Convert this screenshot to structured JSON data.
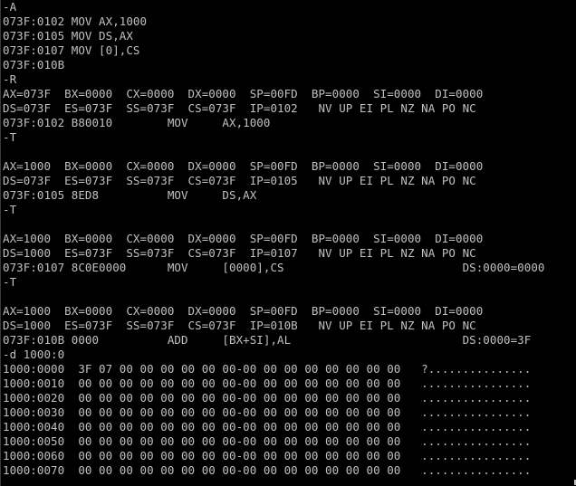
{
  "console": {
    "lines": [
      "-A",
      "073F:0102 MOV AX,1000",
      "073F:0105 MOV DS,AX",
      "073F:0107 MOV [0],CS",
      "073F:010B",
      "-R",
      "AX=073F  BX=0000  CX=0000  DX=0000  SP=00FD  BP=0000  SI=0000  DI=0000",
      "DS=073F  ES=073F  SS=073F  CS=073F  IP=0102   NV UP EI PL NZ NA PO NC",
      "073F:0102 B80010        MOV     AX,1000",
      "-T",
      "",
      "AX=1000  BX=0000  CX=0000  DX=0000  SP=00FD  BP=0000  SI=0000  DI=0000",
      "DS=073F  ES=073F  SS=073F  CS=073F  IP=0105   NV UP EI PL NZ NA PO NC",
      "073F:0105 8ED8          MOV     DS,AX",
      "-T",
      "",
      "AX=1000  BX=0000  CX=0000  DX=0000  SP=00FD  BP=0000  SI=0000  DI=0000",
      "DS=1000  ES=073F  SS=073F  CS=073F  IP=0107   NV UP EI PL NZ NA PO NC",
      "073F:0107 8C0E0000      MOV     [0000],CS                          DS:0000=0000",
      "-T",
      "",
      "AX=1000  BX=0000  CX=0000  DX=0000  SP=00FD  BP=0000  SI=0000  DI=0000",
      "DS=1000  ES=073F  SS=073F  CS=073F  IP=010B   NV UP EI PL NZ NA PO NC",
      "073F:010B 0000          ADD     [BX+SI],AL                         DS:0000=3F",
      "-d 1000:0",
      "1000:0000  3F 07 00 00 00 00 00 00-00 00 00 00 00 00 00 00   ?...............",
      "1000:0010  00 00 00 00 00 00 00 00-00 00 00 00 00 00 00 00   ................",
      "1000:0020  00 00 00 00 00 00 00 00-00 00 00 00 00 00 00 00   ................",
      "1000:0030  00 00 00 00 00 00 00 00-00 00 00 00 00 00 00 00   ................",
      "1000:0040  00 00 00 00 00 00 00 00-00 00 00 00 00 00 00 00   ................",
      "1000:0050  00 00 00 00 00 00 00 00-00 00 00 00 00 00 00 00   ................",
      "1000:0060  00 00 00 00 00 00 00 00-00 00 00 00 00 00 00 00   ................",
      "1000:0070  00 00 00 00 00 00 00 00-00 00 00 00 00 00 00 00   ................"
    ]
  },
  "colors": {
    "background": "#000000",
    "text": "#c0c0c0"
  }
}
